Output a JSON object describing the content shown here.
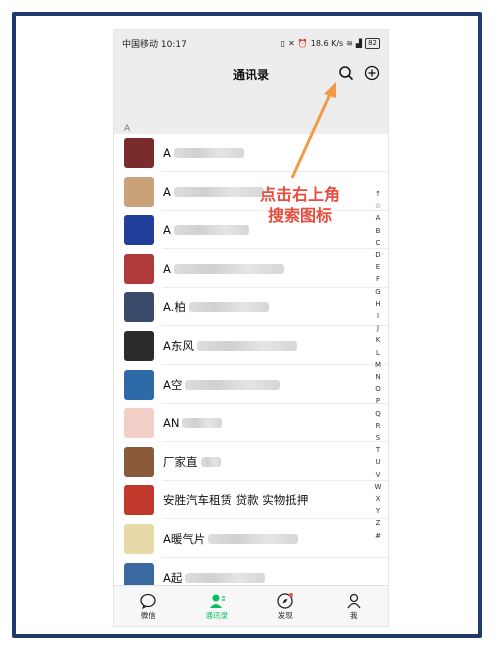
{
  "statusbar": {
    "carrier": "中国移动",
    "time": "10:17",
    "speed": "18.6 K/s",
    "battery": "82"
  },
  "header": {
    "title": "通讯录"
  },
  "section": {
    "letter": "A"
  },
  "contacts": [
    {
      "name": "A",
      "avatar_color": "#7a2b2b"
    },
    {
      "name": "A",
      "avatar_color": "#c9a27a"
    },
    {
      "name": "A",
      "avatar_color": "#1f3f9a"
    },
    {
      "name": "A",
      "avatar_color": "#b03a3a"
    },
    {
      "name": "A.柏",
      "avatar_color": "#3a4a6a"
    },
    {
      "name": "A东风",
      "avatar_color": "#2b2b2b"
    },
    {
      "name": "A空",
      "avatar_color": "#2f6aa8"
    },
    {
      "name": "AN",
      "avatar_color": "#f2d0c8"
    },
    {
      "name": "厂家直",
      "avatar_color": "#8a5a3a"
    },
    {
      "name": "安胜汽车租赁 贷款 实物抵押",
      "avatar_color": "#c0392b"
    },
    {
      "name": "A暖气片",
      "avatar_color": "#e8d9a8"
    },
    {
      "name": "A起",
      "avatar_color": "#3b6aa0"
    }
  ],
  "index_letters": [
    "↑",
    "☆",
    "A",
    "B",
    "C",
    "D",
    "E",
    "F",
    "G",
    "H",
    "I",
    "J",
    "K",
    "L",
    "M",
    "N",
    "O",
    "P",
    "Q",
    "R",
    "S",
    "T",
    "U",
    "V",
    "W",
    "X",
    "Y",
    "Z",
    "#"
  ],
  "tabs": [
    {
      "label": "微信",
      "icon": "chat-bubble-icon"
    },
    {
      "label": "通讯录",
      "icon": "contacts-icon"
    },
    {
      "label": "发现",
      "icon": "compass-icon"
    },
    {
      "label": "我",
      "icon": "person-icon"
    }
  ],
  "annotation": {
    "line1": "点击右上角",
    "line2": "搜索图标",
    "color": "#e74c3c",
    "arrow_color": "#f39a4a"
  }
}
